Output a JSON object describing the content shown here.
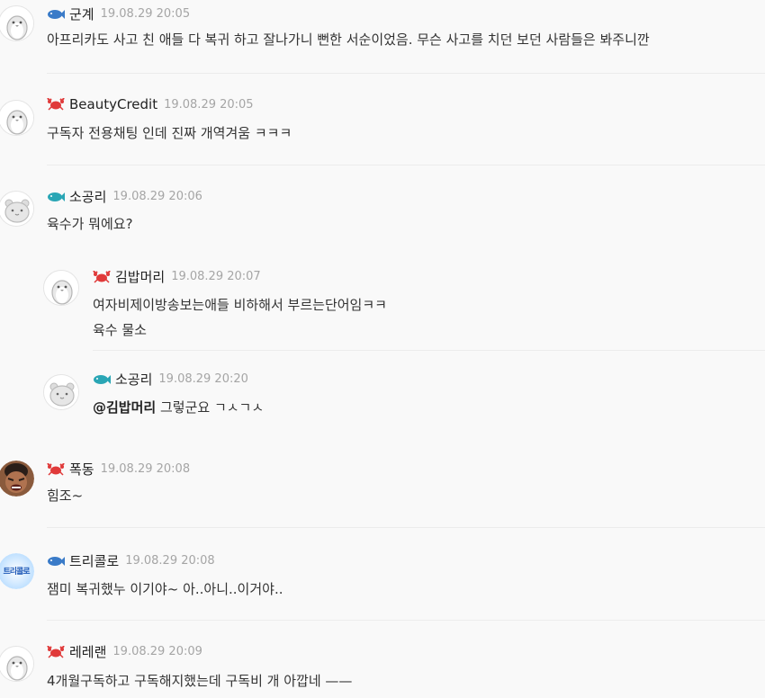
{
  "comments": [
    {
      "name": "군계",
      "time": "19.08.29 20:05",
      "badge": "fish-blue",
      "avatar": "penguin",
      "lines": [
        "아프리카도 사고 친 애들 다 복귀 하고 잘나가니 뻔한 서순이었음. 무슨 사고를 치던 보던 사람들은 봐주니깐"
      ]
    },
    {
      "name": "BeautyCredit",
      "time": "19.08.29 20:05",
      "badge": "crab",
      "avatar": "penguin",
      "lines": [
        "구독자 전용채팅 인데 진짜 개역겨움 ㅋㅋㅋ"
      ]
    },
    {
      "name": "소공리",
      "time": "19.08.29 20:06",
      "badge": "fish-teal",
      "avatar": "hamster",
      "lines": [
        "육수가 뭐에요?"
      ]
    },
    {
      "name": "김밥머리",
      "time": "19.08.29 20:07",
      "badge": "crab",
      "avatar": "penguin",
      "reply": true,
      "lines": [
        "여자비제이방송보는애들 비하해서 부르는단어임ㅋㅋ",
        "육수 물소"
      ]
    },
    {
      "name": "소공리",
      "time": "19.08.29 20:20",
      "badge": "fish-teal",
      "avatar": "hamster",
      "reply": true,
      "mention": "@김밥머리",
      "lines": [
        "그렇군요 ㄱㅅㄱㅅ"
      ]
    },
    {
      "name": "폭동",
      "time": "19.08.29 20:08",
      "badge": "crab",
      "avatar": "photo",
      "lines": [
        "힘조~"
      ]
    },
    {
      "name": "트리콜로",
      "time": "19.08.29 20:08",
      "badge": "fish-blue",
      "avatar": "text",
      "avatar_text": "트리콜로",
      "lines": [
        "잼미 복귀했누 이기야~ 아..아니..이거야.."
      ]
    },
    {
      "name": "레레랜",
      "time": "19.08.29 20:09",
      "badge": "crab",
      "avatar": "penguin",
      "lines": [
        "4개월구독하고 구독해지했는데 구독비 개 아깝네 ——"
      ]
    }
  ]
}
